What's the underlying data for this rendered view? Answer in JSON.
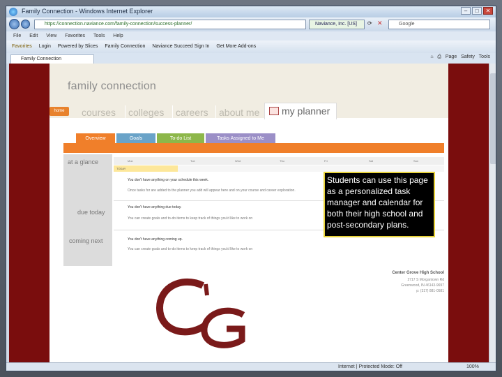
{
  "browser": {
    "title": "Family Connection - Windows Internet Explorer",
    "address": "https://connection.naviance.com/family-connection/success-planner/",
    "security_label": "Naviance, Inc. [US]",
    "search_engine": "Google",
    "menu": [
      "File",
      "Edit",
      "View",
      "Favorites",
      "Tools",
      "Help"
    ],
    "favorites": [
      "Favorites",
      "Login",
      "Powered by Slices",
      "Family Connection",
      "Naviance Succeed Sign In",
      "Get More Add-ons"
    ],
    "tab_label": "Family Connection",
    "tools": [
      "Page",
      "Safety",
      "Tools"
    ],
    "status": "Internet | Protected Mode: Off",
    "zoom": "100%"
  },
  "site": {
    "brand": "family connection",
    "home_label": "home",
    "nav": [
      "courses",
      "colleges",
      "careers",
      "about me"
    ],
    "active_nav": "my planner",
    "subtabs": [
      {
        "label": "Overview",
        "color": "#f07f2a"
      },
      {
        "label": "Goals",
        "color": "#6aa3c8"
      },
      {
        "label": "To-do List",
        "color": "#8db74a"
      },
      {
        "label": "Tasks Assigned to Me",
        "color": "#9b8fc7"
      }
    ],
    "at_a_glance": "at a glance",
    "due_today": "due today",
    "coming_next": "coming next",
    "days": [
      "Mon",
      "Tue",
      "Wed",
      "Thu",
      "Fri",
      "Sat",
      "Sun"
    ],
    "today_label": "TODAY",
    "schedule_msg": "You don't have anything on your schedule this week.",
    "schedule_hint": "Once tasks for are added to the planner you add will appear here and on your course and career exploration.",
    "due_msg": "You don't have anything due today.",
    "due_hint": "You can create goals and to-do items to keep track of things you'd like to work on",
    "coming_msg": "You don't have anything coming up.",
    "coming_hint": "You can create goals and to-do items to keep track of things you'd like to work on"
  },
  "school": {
    "name": "Center Grove High School",
    "addr1": "2717 S Morgantown Rd",
    "addr2": "Greenwood, IN 46143-9697",
    "phone": "p: (317) 881-0581",
    "logo_text": "CG"
  },
  "callout": "Students can use this page as a personalized task manager and calendar for both their high school and post-secondary plans."
}
